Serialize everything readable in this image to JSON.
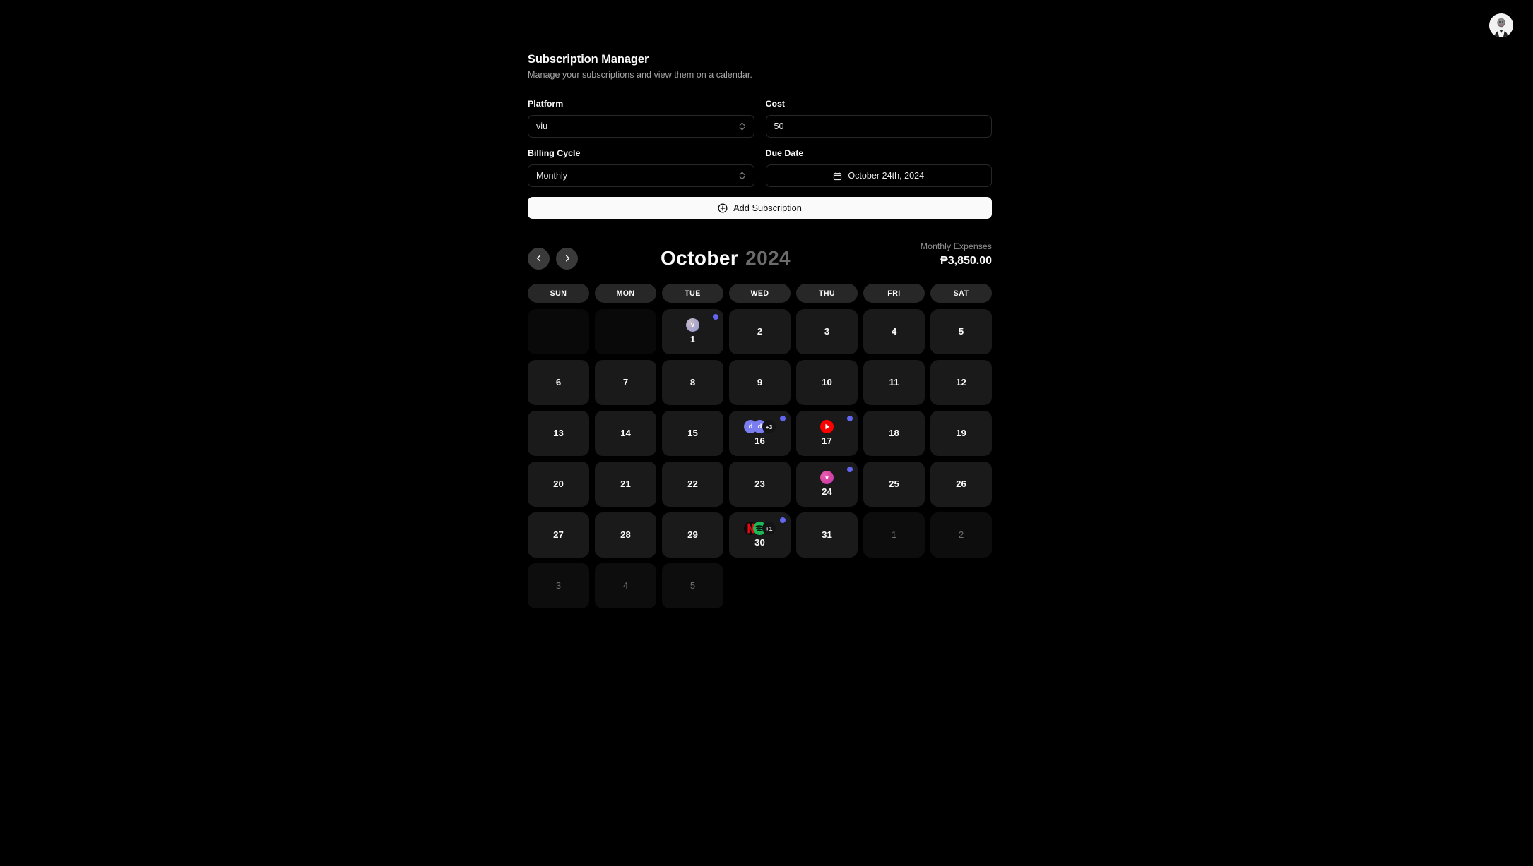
{
  "header": {
    "avatar_name": "user-avatar"
  },
  "page": {
    "title": "Subscription Manager",
    "subtitle": "Manage your subscriptions and view them on a calendar."
  },
  "form": {
    "platform": {
      "label": "Platform",
      "value": "viu"
    },
    "cost": {
      "label": "Cost",
      "value": "50",
      "placeholder": "Cost"
    },
    "billing_cycle": {
      "label": "Billing Cycle",
      "value": "Monthly"
    },
    "due_date": {
      "label": "Due Date",
      "value": "October 24th, 2024"
    },
    "add_button": "Add Subscription"
  },
  "calendar": {
    "prev_label": "‹",
    "next_label": "›",
    "month": "October",
    "year": "2024",
    "expenses_label": "Monthly Expenses",
    "expenses_value": "₱3,850.00",
    "weekdays": [
      "SUN",
      "MON",
      "TUE",
      "WED",
      "THU",
      "FRI",
      "SAT"
    ],
    "accent_dot_color": "#6366f1",
    "weeks": [
      [
        {
          "type": "empty",
          "num": ""
        },
        {
          "type": "empty",
          "num": ""
        },
        {
          "type": "day",
          "num": "1",
          "dot": true,
          "icons": [
            {
              "kind": "viu-a",
              "label": "v"
            }
          ]
        },
        {
          "type": "day",
          "num": "2"
        },
        {
          "type": "day",
          "num": "3"
        },
        {
          "type": "day",
          "num": "4"
        },
        {
          "type": "day",
          "num": "5"
        }
      ],
      [
        {
          "type": "day",
          "num": "6"
        },
        {
          "type": "day",
          "num": "7"
        },
        {
          "type": "day",
          "num": "8"
        },
        {
          "type": "day",
          "num": "9"
        },
        {
          "type": "day",
          "num": "10"
        },
        {
          "type": "day",
          "num": "11"
        },
        {
          "type": "day",
          "num": "12"
        }
      ],
      [
        {
          "type": "day",
          "num": "13"
        },
        {
          "type": "day",
          "num": "14"
        },
        {
          "type": "day",
          "num": "15"
        },
        {
          "type": "day",
          "num": "16",
          "dot": true,
          "icons": [
            {
              "kind": "discord",
              "label": "d"
            },
            {
              "kind": "discord",
              "label": "d"
            }
          ],
          "more": "+3"
        },
        {
          "type": "day",
          "num": "17",
          "dot": true,
          "icons": [
            {
              "kind": "youtube",
              "label": ""
            }
          ]
        },
        {
          "type": "day",
          "num": "18"
        },
        {
          "type": "day",
          "num": "19"
        }
      ],
      [
        {
          "type": "day",
          "num": "20"
        },
        {
          "type": "day",
          "num": "21"
        },
        {
          "type": "day",
          "num": "22"
        },
        {
          "type": "day",
          "num": "23"
        },
        {
          "type": "day",
          "num": "24",
          "dot": true,
          "icons": [
            {
              "kind": "viu-b",
              "label": "v"
            }
          ]
        },
        {
          "type": "day",
          "num": "25"
        },
        {
          "type": "day",
          "num": "26"
        }
      ],
      [
        {
          "type": "day",
          "num": "27"
        },
        {
          "type": "day",
          "num": "28"
        },
        {
          "type": "day",
          "num": "29"
        },
        {
          "type": "day",
          "num": "30",
          "dot": true,
          "icons": [
            {
              "kind": "netflix",
              "label": ""
            },
            {
              "kind": "spotify",
              "label": ""
            }
          ],
          "more": "+1"
        },
        {
          "type": "day",
          "num": "31"
        },
        {
          "type": "other",
          "num": "1"
        },
        {
          "type": "other",
          "num": "2"
        }
      ],
      [
        {
          "type": "other",
          "num": "3"
        },
        {
          "type": "other",
          "num": "4"
        },
        {
          "type": "other",
          "num": "5"
        },
        {
          "type": "blank",
          "num": ""
        },
        {
          "type": "blank",
          "num": ""
        },
        {
          "type": "blank",
          "num": ""
        },
        {
          "type": "blank",
          "num": ""
        }
      ]
    ]
  }
}
